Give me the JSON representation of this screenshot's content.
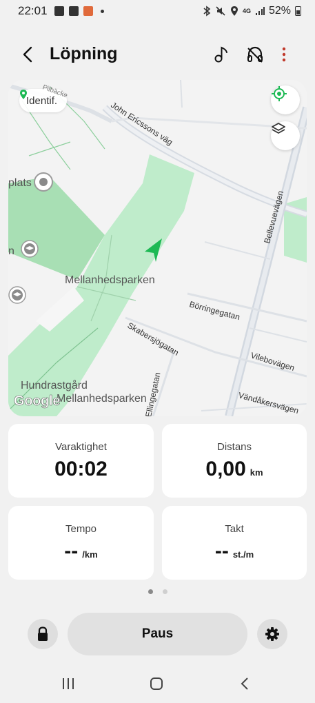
{
  "status_bar": {
    "time": "22:01",
    "network": "4G",
    "battery": "52%",
    "icons": [
      "checkbox-icon",
      "gallery-icon",
      "app-icon",
      "bluetooth-icon",
      "mute-icon",
      "location-icon",
      "signal-icon",
      "battery-icon"
    ]
  },
  "header": {
    "title": "Löpning",
    "icons": [
      "back-arrow-icon",
      "music-note-icon",
      "headphones-icon",
      "more-vert-icon"
    ]
  },
  "map": {
    "identif_chip": "Identif.",
    "park_label": "Mellanhedsparken",
    "park_label_2": "Hundrastgård",
    "park_label_3": "Mellanhedsparken",
    "place_label_1": "plats",
    "place_label_2": "n",
    "streets": {
      "john": "John Ericssons väg",
      "bellevue": "Bellevuevägen",
      "borringe": "Börringegatan",
      "skabersjo": "Skabersjögatan",
      "vilebo": "Vilebovägen",
      "ellinge": "Ellingegatan",
      "vandakers": "Vändåkersvägen",
      "pilbacke": "Pilbäcke"
    },
    "attribution": "Google",
    "accent_color": "#1db954"
  },
  "stats": {
    "duration": {
      "label": "Varaktighet",
      "value": "00:02",
      "unit": ""
    },
    "distance": {
      "label": "Distans",
      "value": "0,00",
      "unit": "km"
    },
    "pace": {
      "label": "Tempo",
      "value": "--",
      "unit": "/km"
    },
    "cadence": {
      "label": "Takt",
      "value": "--",
      "unit": "st./m"
    }
  },
  "pager": {
    "pages": 2,
    "active": 1
  },
  "controls": {
    "pause_label": "Paus"
  }
}
